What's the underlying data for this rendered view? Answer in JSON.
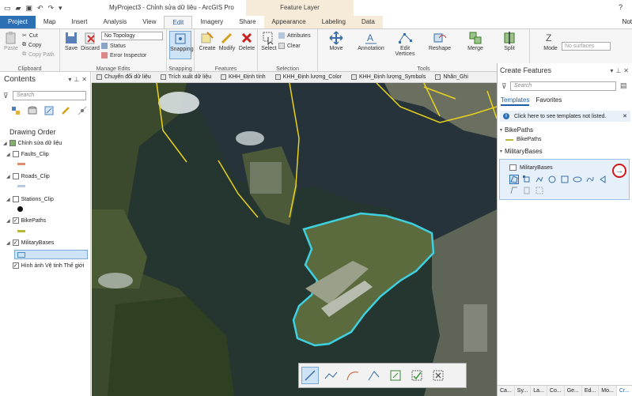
{
  "window": {
    "title": "MyProject3 - Chỉnh sửa dữ liệu - ArcGIS Pro",
    "context_tab": "Feature Layer",
    "help": "?"
  },
  "tabs": [
    "Project",
    "Map",
    "Insert",
    "Analysis",
    "View",
    "Edit",
    "Imagery",
    "Share",
    "Appearance",
    "Labeling",
    "Data"
  ],
  "signin": "Not",
  "ribbon": {
    "clipboard": {
      "paste": "Paste",
      "cut": "Cut",
      "copy": "Copy",
      "copy_path": "Copy Path",
      "label": "Clipboard"
    },
    "manage_edits": {
      "save": "Save",
      "discard": "Discard",
      "topology": "No Topology",
      "status": "Status",
      "error_inspector": "Error Inspector",
      "label": "Manage Edits"
    },
    "snapping": {
      "snapping": "Snapping",
      "label": "Snapping"
    },
    "features": {
      "create": "Create",
      "modify": "Modify",
      "delete": "Delete",
      "label": "Features"
    },
    "selection": {
      "select": "Select",
      "attributes": "Attributes",
      "clear": "Clear",
      "label": "Selection"
    },
    "tools": {
      "move": "Move",
      "annotation": "Annotation",
      "edit_vertices": "Edit Vertices",
      "reshape": "Reshape",
      "merge": "Merge",
      "split": "Split",
      "label": "Tools"
    },
    "elevation": {
      "mode": "Mode",
      "no_surfaces": "No surfaces"
    }
  },
  "contents": {
    "title": "Contents",
    "search_placeholder": "Search",
    "drawing_order": "Drawing Order",
    "map_name": "Chỉnh sửa dữ liệu",
    "layers": [
      {
        "name": "Faults_Clip",
        "checked": false
      },
      {
        "name": "Roads_Clip",
        "checked": false
      },
      {
        "name": "Stations_Clip",
        "checked": false
      },
      {
        "name": "BikePaths",
        "checked": true
      },
      {
        "name": "MilitaryBases",
        "checked": true
      },
      {
        "name": "Hình ảnh Vệ tinh Thế giới",
        "checked": true
      }
    ]
  },
  "map_tabs": [
    "Chuyển đổi dữ liệu",
    "Trích xuất dữ liệu",
    "KHH_Định tính",
    "KHH_Định lượng_Color",
    "KHH_Định lượng_Symbols",
    "Nhãn_Ghi"
  ],
  "create_features": {
    "title": "Create Features",
    "search_placeholder": "Search",
    "tab_templates": "Templates",
    "tab_favorites": "Favorites",
    "info": "Click here to see templates not listed.",
    "groups": [
      {
        "name": "BikePaths",
        "template": "BikePaths"
      },
      {
        "name": "MilitaryBases",
        "template": "MilitaryBases"
      }
    ],
    "bottom_tabs": [
      "Ca...",
      "Sy...",
      "La...",
      "Co...",
      "Ge...",
      "Ed...",
      "Mo...",
      "Cr..."
    ]
  },
  "colors": {
    "project_tab": "#2d6fb5",
    "bikepaths": "#e8d21c",
    "militarybases_outline": "#3fd0e0",
    "accent_circle": "#d01818"
  }
}
